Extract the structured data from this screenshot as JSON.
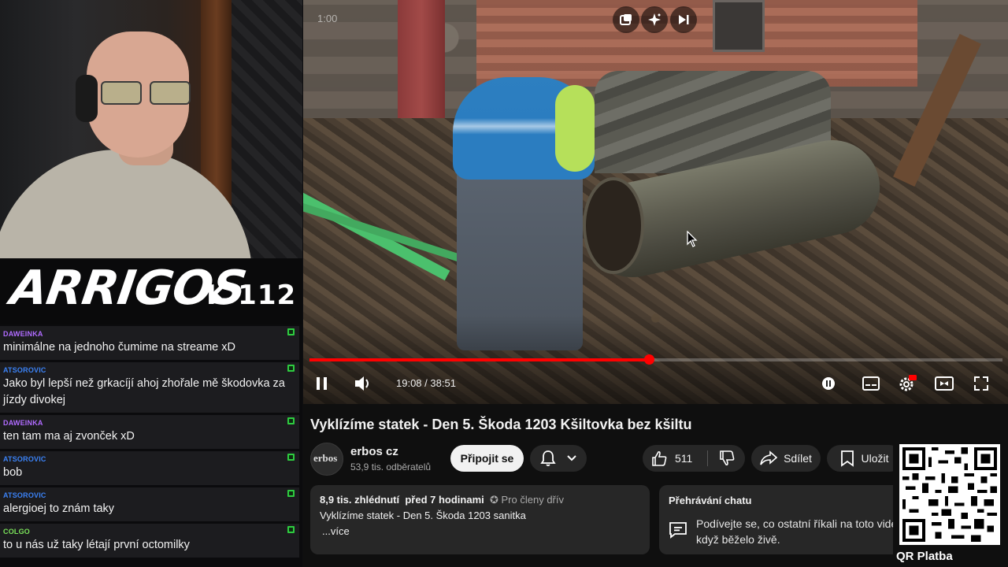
{
  "overlay": {
    "logo_text": "ARRIGOS",
    "logo_sub": "K 112"
  },
  "chat": [
    {
      "user": "DAWEINKA",
      "color": "#b06bff",
      "text": "minimálne na jednoho čumime na streame xD"
    },
    {
      "user": "ATSOROVIC",
      "color": "#3b82f6",
      "text": "Jako byl lepší než grkacíjí ahoj zhořale mě škodovka za jízdy divokej"
    },
    {
      "user": "DAWEINKA",
      "color": "#b06bff",
      "text": "ten tam ma aj zvonček xD"
    },
    {
      "user": "ATSOROVIC",
      "color": "#3b82f6",
      "text": "bob"
    },
    {
      "user": "ATSOROVIC",
      "color": "#3b82f6",
      "text": "alergioej to znám taky"
    },
    {
      "user": "COLGO",
      "color": "#7be35a",
      "text": "to u nás už taky létají první octomilky"
    }
  ],
  "player": {
    "timestamp_overlay": "1:00",
    "current_time": "19:08",
    "separator": " / ",
    "duration": "38:51",
    "progress_fraction": 0.49,
    "accent_color": "#ff0000",
    "top_icons": [
      "miniplayer-icon",
      "sparkle-icon",
      "next-icon"
    ],
    "bottom_icons": [
      "pause-icon",
      "volume-icon",
      "autoplay-toggle-icon",
      "subtitles-icon",
      "settings-hd-icon",
      "theater-icon",
      "fullscreen-icon"
    ]
  },
  "video": {
    "title": "Vyklízíme statek - Den 5. Škoda 1203 Kšiltovka bez kšiltu",
    "channel_name": "erbos cz",
    "channel_avatar_text": "erbos",
    "subscribers": "53,9 tis. odběratelů",
    "join_label": "Připojit se",
    "likes": "511",
    "share_label": "Sdílet",
    "save_label": "Uložit"
  },
  "description": {
    "views": "8,9 tis. zhlédnutí",
    "age": "před 7 hodinami",
    "members": "Pro členy dřív",
    "text": "Vyklízíme statek - Den 5. Škoda 1203 sanitka",
    "more": "...více"
  },
  "chat_replay": {
    "title": "Přehrávání chatu",
    "text": "Podívejte se, co ostatní říkali na toto vide když běželo živě."
  },
  "qr": {
    "label": "QR Platba"
  }
}
